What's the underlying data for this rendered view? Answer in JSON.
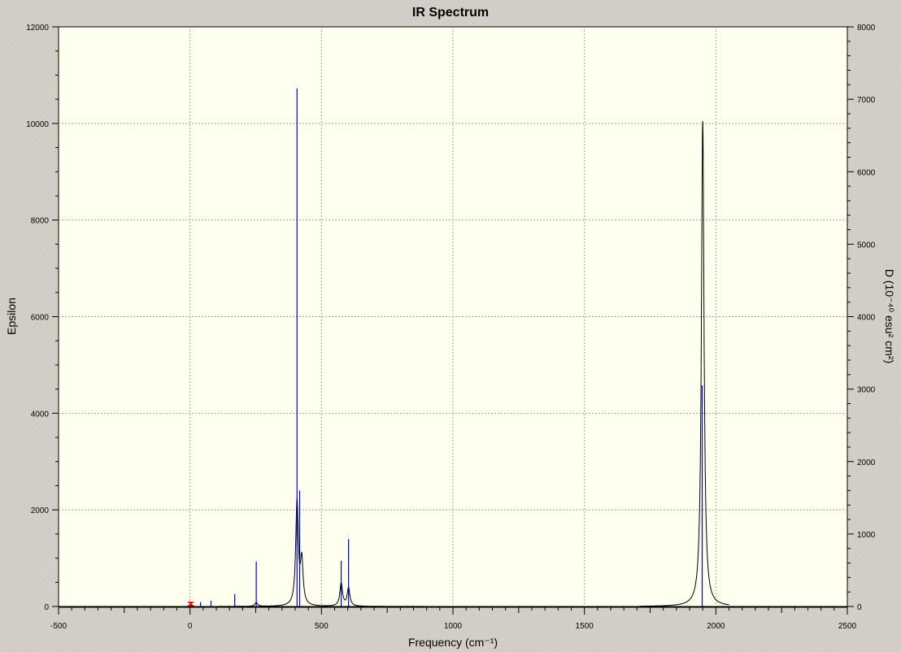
{
  "chart_data": {
    "type": "line",
    "title": "IR Spectrum",
    "xlabel": "Frequency (cm⁻¹)",
    "ylabel_left": "Epsilon",
    "ylabel_right": "D (10⁻⁴⁰ esu² cm²)",
    "xlim": [
      -500,
      2500
    ],
    "ylim_left": [
      0,
      12000
    ],
    "ylim_right": [
      0,
      8000
    ],
    "x_tick_labels": [
      "-500",
      "0",
      "500",
      "1000",
      "1500",
      "2000",
      "2500"
    ],
    "y_left_tick_labels": [
      "0",
      "2000",
      "4000",
      "6000",
      "8000",
      "10000",
      "12000"
    ],
    "y_right_tick_labels": [
      "0",
      "1000",
      "2000",
      "3000",
      "4000",
      "5000",
      "6000",
      "7000",
      "8000"
    ],
    "grid": true,
    "colors": {
      "plot_bg": "#fffff0",
      "spectrum": "#000000",
      "stick": "#0000cc",
      "grid": "#a0a0a0",
      "marker": "#ee0000"
    },
    "spectrum_segments": [
      {
        "x_range": [
          110,
          1140
        ],
        "peaks": [
          {
            "x": 252,
            "epsilon": 80
          },
          {
            "x": 407,
            "epsilon": 2150
          },
          {
            "x": 425,
            "epsilon": 900
          },
          {
            "x": 575,
            "epsilon": 480
          },
          {
            "x": 603,
            "epsilon": 380
          }
        ]
      },
      {
        "x_range": [
          1710,
          2050
        ],
        "peaks": [
          {
            "x": 1950,
            "epsilon": 10050
          }
        ]
      }
    ],
    "sticks": [
      {
        "x": 40,
        "D": 60
      },
      {
        "x": 80,
        "D": 80
      },
      {
        "x": 170,
        "D": 170
      },
      {
        "x": 252,
        "D": 620
      },
      {
        "x": 407,
        "D": 7150
      },
      {
        "x": 417,
        "D": 1600
      },
      {
        "x": 575,
        "D": 630
      },
      {
        "x": 603,
        "D": 930
      },
      {
        "x": 1948,
        "D": 3050
      }
    ],
    "marker": {
      "x": 3,
      "D": 60
    }
  }
}
